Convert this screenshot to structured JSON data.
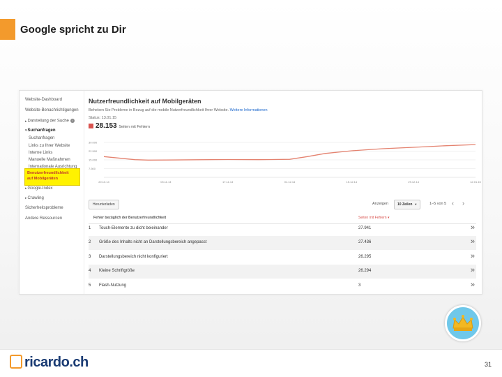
{
  "slide": {
    "title": "Google spricht zu Dir",
    "page_number": "31"
  },
  "sidebar": {
    "items": [
      "Website-Dashboard",
      "Website-Benachrichtigungen",
      "Darstellung der Suche",
      "Suchanfragen",
      "Suchanfragen",
      "Links zu Ihrer Website",
      "Interne Links",
      "Manuelle Maßnahmen",
      "Internationale Ausrichtung",
      "Google-Index",
      "Crawling",
      "Sicherheitsprobleme",
      "Andere Ressourcen"
    ],
    "highlighted_line1": "Benutzerfreundlichkeit",
    "highlighted_line2": "auf Mobilgeräten"
  },
  "main": {
    "title": "Nutzerfreundlichkeit auf Mobilgeräten",
    "description": "Beheben Sie Probleme in Bezug auf die mobile Nutzerfreundlichkeit Ihrer Website.",
    "more_link": "Weitere Informationen",
    "status": "Status: 13.01.15",
    "error_count": "28.153",
    "error_suffix": "Seiten mit Fehlern",
    "download_label": "Herunterladen",
    "show_label": "Anzeigen",
    "rows_option": "10 Zeilen",
    "range_text": "1–5 von 5"
  },
  "table": {
    "col_issue": "Fehler bezüglich der Benutzerfreundlichkeit",
    "col_pages": "Seiten mit Fehlern",
    "rows": [
      {
        "num": "1",
        "issue": "Touch-Elemente zu dicht beieinander",
        "value": "27.941"
      },
      {
        "num": "2",
        "issue": "Größe des Inhalts nicht an Darstellungsbereich angepasst",
        "value": "27.436"
      },
      {
        "num": "3",
        "issue": "Darstellungsbereich nicht konfiguriert",
        "value": "26.295"
      },
      {
        "num": "4",
        "issue": "Kleine Schriftgröße",
        "value": "26.294"
      },
      {
        "num": "5",
        "issue": "Flash-Nutzung",
        "value": "3"
      }
    ]
  },
  "chart_data": {
    "type": "line",
    "y_ticks": [
      "30.000",
      "22.500",
      "15.000",
      "7.500"
    ],
    "ylim": [
      0,
      30000
    ],
    "x_tick_labels": [
      "20.10.14",
      "03.11.14",
      "17.11.14",
      "01.12.14",
      "15.12.14",
      "29.12.14",
      "12.01.15"
    ],
    "x_ticks": [
      0,
      14,
      28,
      42,
      56,
      70,
      84
    ],
    "series": [
      {
        "x": [
          0,
          3,
          7,
          10,
          14,
          21,
          28,
          35,
          42,
          46,
          50,
          56,
          63,
          70,
          77,
          84
        ],
        "values": [
          17800,
          16700,
          15200,
          14800,
          14900,
          15100,
          15300,
          15200,
          15500,
          17800,
          20500,
          22800,
          24600,
          25800,
          27100,
          28153
        ]
      }
    ],
    "colors": {
      "line": "#e4826f",
      "grid": "#e3e3e3"
    },
    "grid": true
  },
  "icons": {
    "crown": "crown-icon",
    "pager_prev": "chevron-left-icon",
    "pager_next": "chevron-right-icon",
    "row_open": "double-chevron-right-icon"
  },
  "brand": {
    "logo_text": "ricardo",
    "logo_suffix": ".ch",
    "accent": "#f39a2c",
    "logo_color": "#1a3b73"
  }
}
